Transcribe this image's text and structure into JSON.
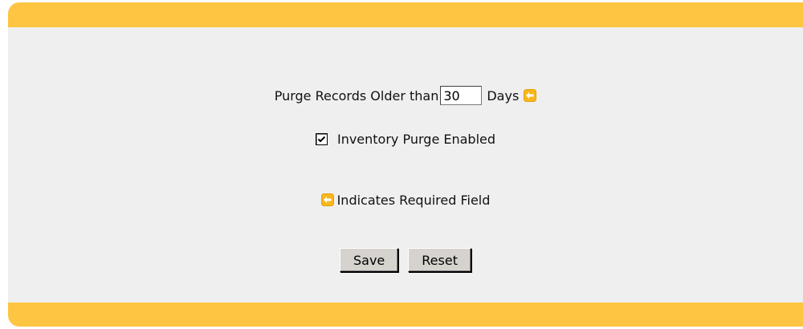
{
  "form": {
    "purge_label_prefix": "Purge Records Older than",
    "purge_days_value": "30",
    "purge_label_suffix": "Days",
    "inventory_purge_label": "Inventory Purge Enabled",
    "inventory_purge_checked": true,
    "required_legend_text": "Indicates Required Field",
    "save_label": "Save",
    "reset_label": "Reset"
  },
  "icons": {
    "required": "required-field-arrow-icon",
    "checkmark": "checkmark-icon"
  },
  "colors": {
    "accent_bar": "#fec542",
    "panel_background": "#efefef",
    "button_face": "#d6d3ce"
  }
}
